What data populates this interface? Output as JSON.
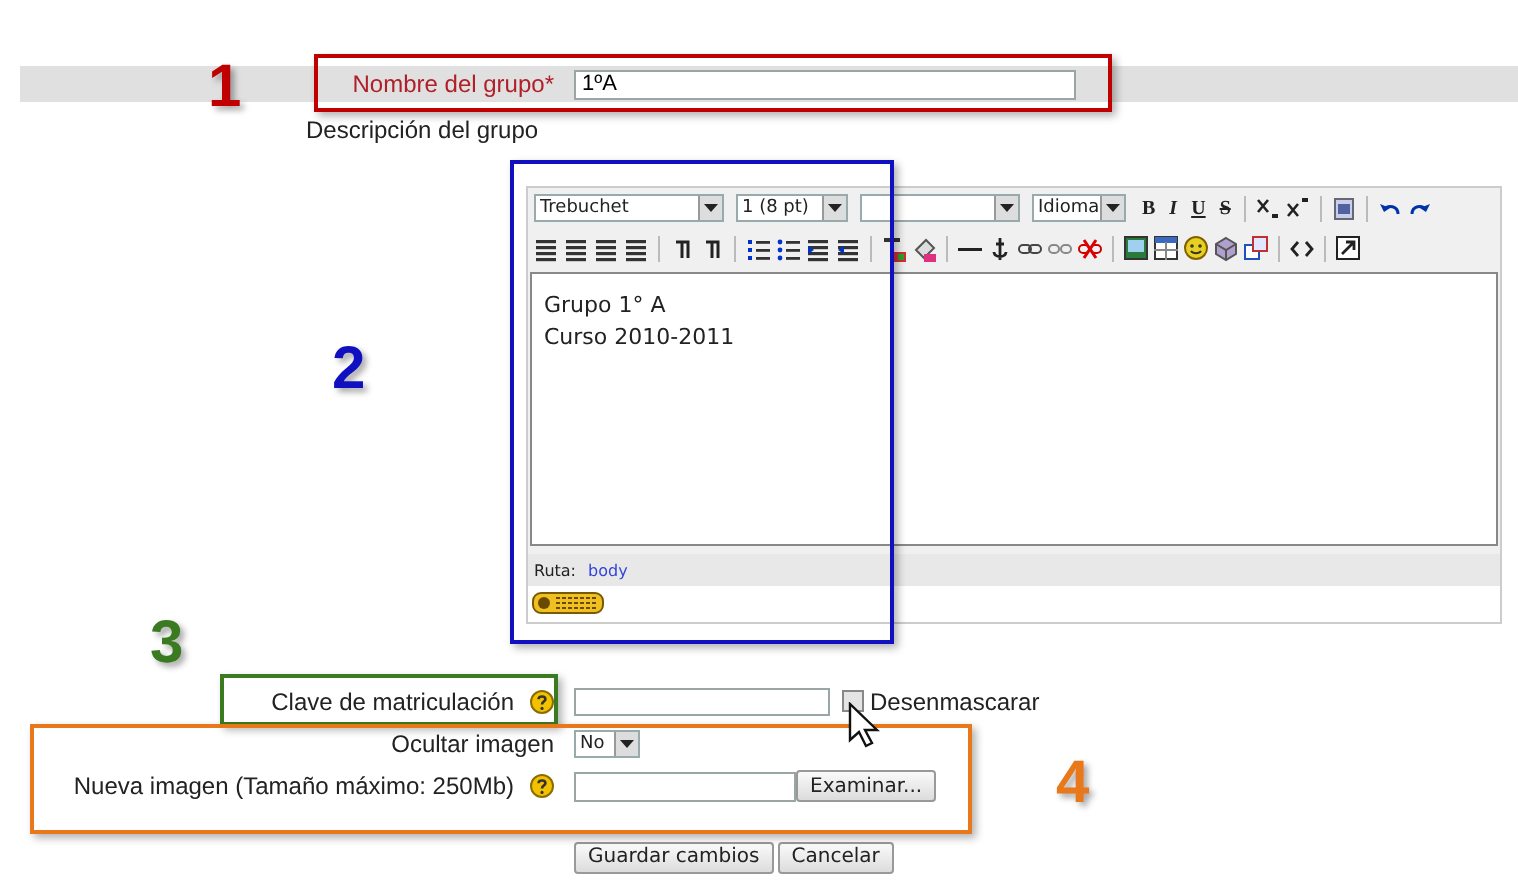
{
  "group_name": {
    "label": "Nombre del grupo*",
    "value": "1ºA"
  },
  "description_label": "Descripción del grupo",
  "editor": {
    "font": "Trebuchet",
    "size": "1 (8 pt)",
    "language": "Idioma",
    "format_buttons": [
      "B",
      "I",
      "U",
      "S"
    ],
    "content": [
      "Grupo 1° A",
      "Curso 2010-2011"
    ],
    "path_label": "Ruta:",
    "path_link": "body"
  },
  "enrolment_key": {
    "label": "Clave de matriculación",
    "unmask_label": "Desenmascarar",
    "unmask_checked": false
  },
  "hide_picture": {
    "label": "Ocultar imagen",
    "value": "No"
  },
  "new_picture": {
    "label": "Nueva imagen (Tamaño máximo: 250Mb)",
    "browse": "Examinar..."
  },
  "buttons": [
    "Guardar cambios",
    "Cancelar"
  ],
  "annotations": [
    {
      "number": "1",
      "color": "#c00000"
    },
    {
      "number": "2",
      "color": "#1010c0"
    },
    {
      "number": "3",
      "color": "#3a7a20"
    },
    {
      "number": "4",
      "color": "#e8781a"
    }
  ]
}
